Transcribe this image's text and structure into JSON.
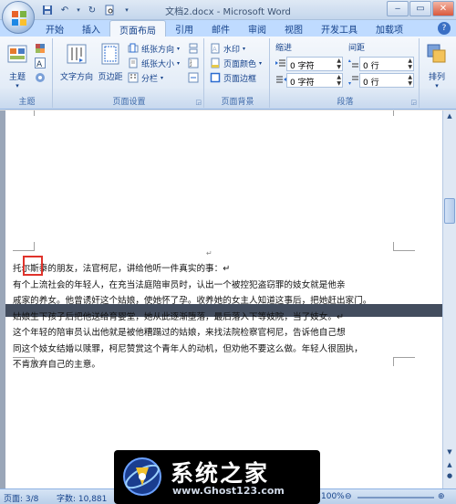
{
  "window": {
    "title": "文档2.docx - Microsoft Word"
  },
  "tabs": [
    "开始",
    "插入",
    "页面布局",
    "引用",
    "邮件",
    "审阅",
    "视图",
    "开发工具",
    "加载项"
  ],
  "ribbon": {
    "theme_group": {
      "label": "主题",
      "theme_button": "主题"
    },
    "page_setup_group": {
      "label": "页面设置",
      "text_direction": "文字方向",
      "margins": "页边距",
      "orientation": "纸张方向",
      "size": "纸张大小",
      "columns": "分栏"
    },
    "page_background_group": {
      "label": "页面背景",
      "watermark": "水印",
      "page_color": "页面颜色",
      "page_borders": "页面边框"
    },
    "paragraph_group": {
      "label": "段落",
      "indent_label": "缩进",
      "spacing_label": "间距",
      "indent_left": "0 字符",
      "indent_right": "0 字符",
      "spacing_before": "0 行",
      "spacing_after": "0 行"
    },
    "arrange_group": {
      "arrange": "排列"
    }
  },
  "document": {
    "lines": [
      "托尔斯泰的朋友，法官柯尼，讲给他听一件真实的事：↵",
      "    有个上流社会的年轻人，在充当法庭陪审员时，认出一个被控犯盗窃罪的妓女就是他亲",
      "戚家的养女。他曾诱奸这个姑娘，使她怀了孕。收养她的女主人知道这事后，把她赶出家门。",
      "姑娘生下孩子后把他送给育婴堂，她从此逐渐堕落，最后落入下等妓院，当了妓女。↵",
      "    这个年轻的陪审员认出他就是被他糟蹋过的姑娘，来找法院检察官柯尼，告诉他自己想",
      "同这个妓女结婚以赎罪，柯尼赞赏这个青年人的动机，但劝他不要这么做。年轻人很固执，",
      "不肯放弃自己的主意。"
    ]
  },
  "statusbar": {
    "page": "页面: 3/8",
    "words": "字数: 10,881",
    "zoom": "100%"
  },
  "watermark": {
    "brand": "系统之家",
    "url": "www.Ghost123.com"
  }
}
